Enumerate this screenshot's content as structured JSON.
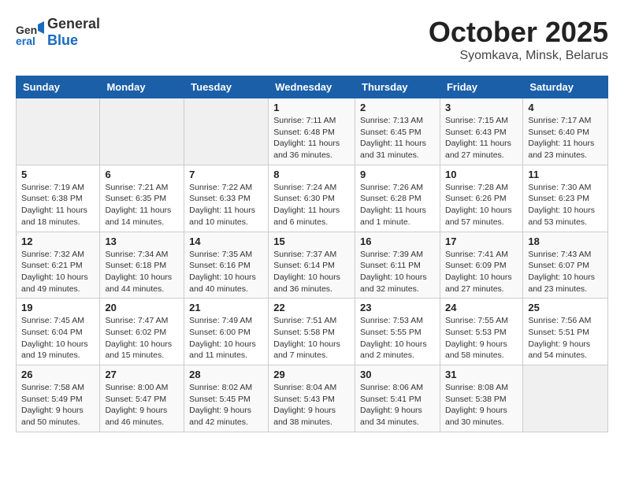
{
  "header": {
    "logo_general": "General",
    "logo_blue": "Blue",
    "month_title": "October 2025",
    "location": "Syomkava, Minsk, Belarus"
  },
  "weekdays": [
    "Sunday",
    "Monday",
    "Tuesday",
    "Wednesday",
    "Thursday",
    "Friday",
    "Saturday"
  ],
  "weeks": [
    [
      {
        "day": "",
        "info": ""
      },
      {
        "day": "",
        "info": ""
      },
      {
        "day": "",
        "info": ""
      },
      {
        "day": "1",
        "info": "Sunrise: 7:11 AM\nSunset: 6:48 PM\nDaylight: 11 hours and 36 minutes."
      },
      {
        "day": "2",
        "info": "Sunrise: 7:13 AM\nSunset: 6:45 PM\nDaylight: 11 hours and 31 minutes."
      },
      {
        "day": "3",
        "info": "Sunrise: 7:15 AM\nSunset: 6:43 PM\nDaylight: 11 hours and 27 minutes."
      },
      {
        "day": "4",
        "info": "Sunrise: 7:17 AM\nSunset: 6:40 PM\nDaylight: 11 hours and 23 minutes."
      }
    ],
    [
      {
        "day": "5",
        "info": "Sunrise: 7:19 AM\nSunset: 6:38 PM\nDaylight: 11 hours and 18 minutes."
      },
      {
        "day": "6",
        "info": "Sunrise: 7:21 AM\nSunset: 6:35 PM\nDaylight: 11 hours and 14 minutes."
      },
      {
        "day": "7",
        "info": "Sunrise: 7:22 AM\nSunset: 6:33 PM\nDaylight: 11 hours and 10 minutes."
      },
      {
        "day": "8",
        "info": "Sunrise: 7:24 AM\nSunset: 6:30 PM\nDaylight: 11 hours and 6 minutes."
      },
      {
        "day": "9",
        "info": "Sunrise: 7:26 AM\nSunset: 6:28 PM\nDaylight: 11 hours and 1 minute."
      },
      {
        "day": "10",
        "info": "Sunrise: 7:28 AM\nSunset: 6:26 PM\nDaylight: 10 hours and 57 minutes."
      },
      {
        "day": "11",
        "info": "Sunrise: 7:30 AM\nSunset: 6:23 PM\nDaylight: 10 hours and 53 minutes."
      }
    ],
    [
      {
        "day": "12",
        "info": "Sunrise: 7:32 AM\nSunset: 6:21 PM\nDaylight: 10 hours and 49 minutes."
      },
      {
        "day": "13",
        "info": "Sunrise: 7:34 AM\nSunset: 6:18 PM\nDaylight: 10 hours and 44 minutes."
      },
      {
        "day": "14",
        "info": "Sunrise: 7:35 AM\nSunset: 6:16 PM\nDaylight: 10 hours and 40 minutes."
      },
      {
        "day": "15",
        "info": "Sunrise: 7:37 AM\nSunset: 6:14 PM\nDaylight: 10 hours and 36 minutes."
      },
      {
        "day": "16",
        "info": "Sunrise: 7:39 AM\nSunset: 6:11 PM\nDaylight: 10 hours and 32 minutes."
      },
      {
        "day": "17",
        "info": "Sunrise: 7:41 AM\nSunset: 6:09 PM\nDaylight: 10 hours and 27 minutes."
      },
      {
        "day": "18",
        "info": "Sunrise: 7:43 AM\nSunset: 6:07 PM\nDaylight: 10 hours and 23 minutes."
      }
    ],
    [
      {
        "day": "19",
        "info": "Sunrise: 7:45 AM\nSunset: 6:04 PM\nDaylight: 10 hours and 19 minutes."
      },
      {
        "day": "20",
        "info": "Sunrise: 7:47 AM\nSunset: 6:02 PM\nDaylight: 10 hours and 15 minutes."
      },
      {
        "day": "21",
        "info": "Sunrise: 7:49 AM\nSunset: 6:00 PM\nDaylight: 10 hours and 11 minutes."
      },
      {
        "day": "22",
        "info": "Sunrise: 7:51 AM\nSunset: 5:58 PM\nDaylight: 10 hours and 7 minutes."
      },
      {
        "day": "23",
        "info": "Sunrise: 7:53 AM\nSunset: 5:55 PM\nDaylight: 10 hours and 2 minutes."
      },
      {
        "day": "24",
        "info": "Sunrise: 7:55 AM\nSunset: 5:53 PM\nDaylight: 9 hours and 58 minutes."
      },
      {
        "day": "25",
        "info": "Sunrise: 7:56 AM\nSunset: 5:51 PM\nDaylight: 9 hours and 54 minutes."
      }
    ],
    [
      {
        "day": "26",
        "info": "Sunrise: 7:58 AM\nSunset: 5:49 PM\nDaylight: 9 hours and 50 minutes."
      },
      {
        "day": "27",
        "info": "Sunrise: 8:00 AM\nSunset: 5:47 PM\nDaylight: 9 hours and 46 minutes."
      },
      {
        "day": "28",
        "info": "Sunrise: 8:02 AM\nSunset: 5:45 PM\nDaylight: 9 hours and 42 minutes."
      },
      {
        "day": "29",
        "info": "Sunrise: 8:04 AM\nSunset: 5:43 PM\nDaylight: 9 hours and 38 minutes."
      },
      {
        "day": "30",
        "info": "Sunrise: 8:06 AM\nSunset: 5:41 PM\nDaylight: 9 hours and 34 minutes."
      },
      {
        "day": "31",
        "info": "Sunrise: 8:08 AM\nSunset: 5:38 PM\nDaylight: 9 hours and 30 minutes."
      },
      {
        "day": "",
        "info": ""
      }
    ]
  ]
}
